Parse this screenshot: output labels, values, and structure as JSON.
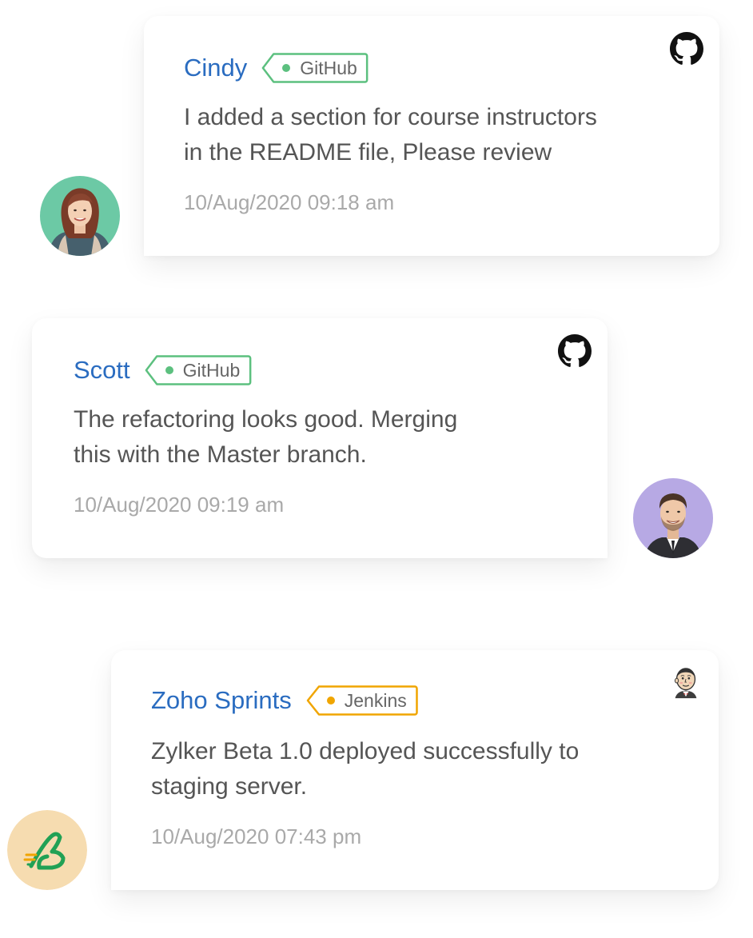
{
  "colors": {
    "name": "#2a6cc0",
    "github_tag": "#5cc07f",
    "jenkins_tag": "#f0a500",
    "text": "#555555",
    "timestamp": "#a9a9a9",
    "avatar_cindy_bg": "#6cc9a5",
    "avatar_scott_bg": "#b7a9e4",
    "avatar_sprints_bg": "#f6dcb0"
  },
  "messages": [
    {
      "author": "Cindy",
      "tag": "GitHub",
      "source_icon": "github-icon",
      "line1": "I added a section for course instructors",
      "line2": "in the README file, Please review",
      "timestamp": "10/Aug/2020 09:18 am"
    },
    {
      "author": "Scott",
      "tag": "GitHub",
      "source_icon": "github-icon",
      "line1": "The refactoring looks good. Merging",
      "line2": "this with the Master branch.",
      "timestamp": "10/Aug/2020 09:19 am"
    },
    {
      "author": "Zoho Sprints",
      "tag": "Jenkins",
      "source_icon": "jenkins-icon",
      "line1": "Zylker Beta 1.0 deployed successfully to",
      "line2": "staging server.",
      "timestamp": "10/Aug/2020 07:43 pm"
    }
  ]
}
